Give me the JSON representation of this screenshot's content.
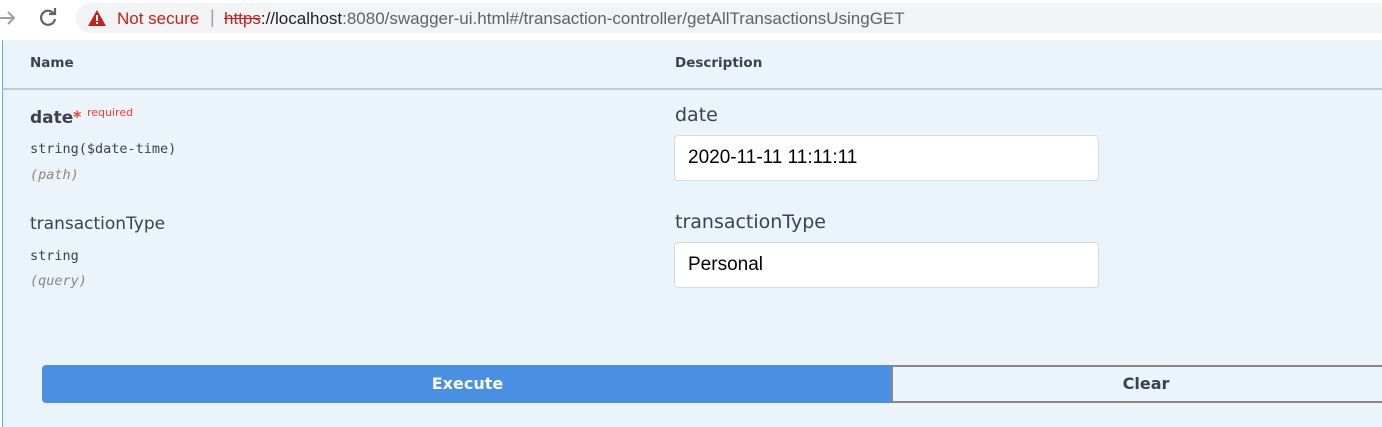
{
  "browser": {
    "security_text": "Not secure",
    "separator": "|",
    "url_scheme": "https",
    "url_host": "://localhost",
    "url_path": ":8080/swagger-ui.html#/transaction-controller/getAllTransactionsUsingGET",
    "icons": {
      "forward": "arrow-right-icon",
      "reload": "reload-icon",
      "warning": "warning-triangle-icon"
    },
    "colors": {
      "warning": "#c5221f"
    }
  },
  "table": {
    "headers": {
      "name": "Name",
      "description": "Description"
    }
  },
  "params": [
    {
      "name": "date",
      "required_star": "*",
      "required_label": "required",
      "type": "string($date-time)",
      "in": "(path)",
      "input_label": "date",
      "value": "2020-11-11 11:11:11"
    },
    {
      "name": "transactionType",
      "type": "string",
      "in": "(query)",
      "input_label": "transactionType",
      "value": "Personal"
    }
  ],
  "actions": {
    "execute": "Execute",
    "clear": "Clear"
  },
  "colors": {
    "execute": "#4990e2",
    "panel_bg": "#ebf3fb",
    "required": "#ff3b30"
  }
}
